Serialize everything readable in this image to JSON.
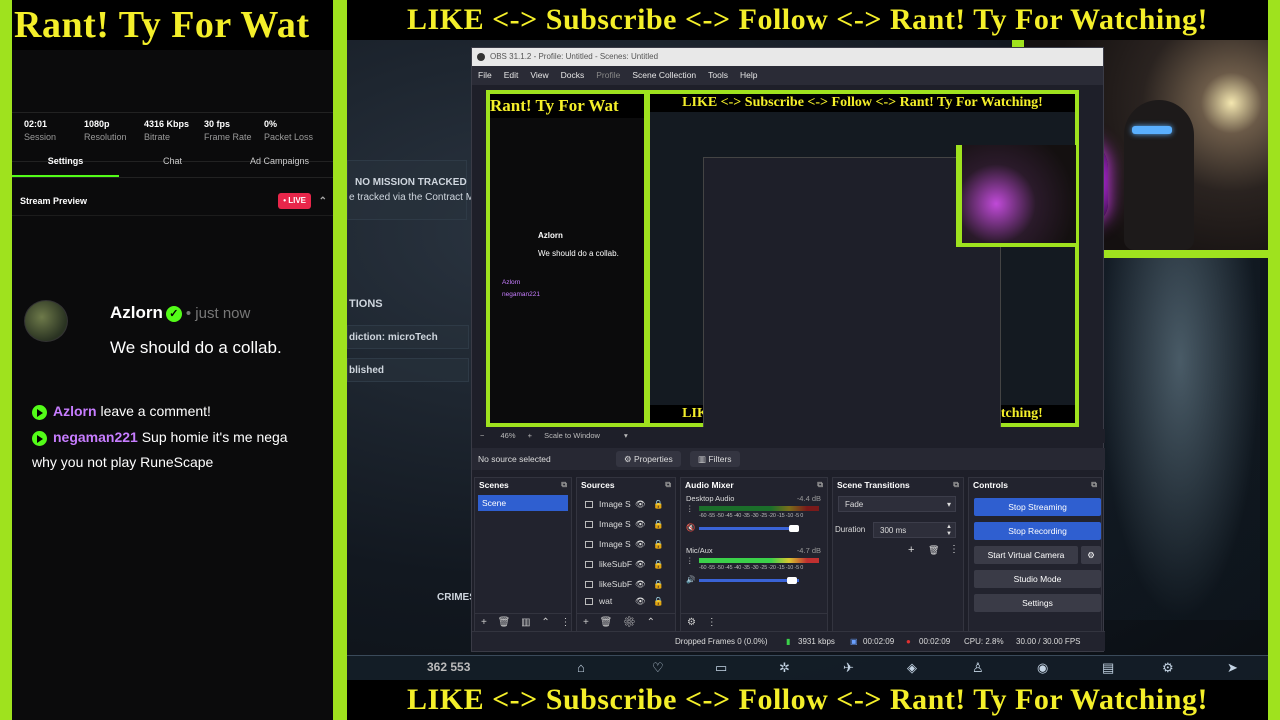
{
  "banners": {
    "left": "Rant! Ty For Wat",
    "top": "LIKE <-> Subscribe <-> Follow <-> Rant! Ty For Watching!",
    "bottom": "LIKE <-> Subscribe <-> Follow <-> Rant! Ty For Watching!"
  },
  "stream": {
    "stats": [
      {
        "value": "02:01",
        "label": "Session"
      },
      {
        "value": "1080p",
        "label": "Resolution"
      },
      {
        "value": "4316 Kbps",
        "label": "Bitrate"
      },
      {
        "value": "30 fps",
        "label": "Frame Rate"
      },
      {
        "value": "0%",
        "label": "Packet Loss"
      }
    ],
    "tabs": [
      "Settings",
      "Chat",
      "Ad Campaigns"
    ],
    "preview_label": "Stream Preview",
    "live_label": "• LIVE"
  },
  "chat": {
    "user": "Azlorn",
    "time": "• just now",
    "message": "We should do a collab.",
    "events": [
      {
        "who": "Azlorn",
        "text": "leave a comment!"
      },
      {
        "who": "negaman221",
        "text": "Sup homie it's me nega"
      }
    ],
    "event_continuation": "why you not play RuneScape"
  },
  "game": {
    "mission": "NO MISSION TRACKED",
    "tracked": "e tracked via the Contract M",
    "section": "TIONS",
    "jurisdiction": "diction: microTech",
    "established": "blished",
    "crime": "CRIMES",
    "score": "362 553"
  },
  "obs": {
    "title": "OBS 31.1.2 - Profile: Untitled - Scenes: Untitled",
    "menu": [
      "File",
      "Edit",
      "View",
      "Docks",
      "Profile",
      "Scene Collection",
      "Tools",
      "Help"
    ],
    "zoom": "46%",
    "scale_mode": "Scale to Window",
    "no_source": "No source selected",
    "properties": "Properties",
    "filters": "Filters",
    "docks": {
      "scenes": "Scenes",
      "sources": "Sources",
      "mixer": "Audio Mixer",
      "transitions": "Scene Transitions",
      "controls": "Controls"
    },
    "scene_items": [
      "Scene"
    ],
    "sources": [
      "Image S",
      "Image S",
      "Image S",
      "likeSubF",
      "likeSubF",
      "wat"
    ],
    "mixer": [
      {
        "name": "Desktop Audio",
        "db": "-4.4 dB"
      },
      {
        "name": "Mic/Aux",
        "db": "-4.7 dB"
      }
    ],
    "meter_scale": "-60 -55 -50 -45 -40 -35 -30 -25 -20 -15 -10 -5 0",
    "transition": "Fade",
    "duration_label": "Duration",
    "duration_value": "300 ms",
    "controls": [
      "Stop Streaming",
      "Stop Recording",
      "Start Virtual Camera",
      "Studio Mode",
      "Settings"
    ],
    "status": {
      "dropped": "Dropped Frames 0 (0.0%)",
      "kbps": "3931 kbps",
      "stream_time": "00:02:09",
      "rec_time": "00:02:09",
      "cpu": "CPU: 2.8%",
      "fps": "30.00 / 30.00 FPS"
    }
  },
  "colors": {
    "frame": "#9fe21e",
    "banner_text": "#f4ef2a",
    "kick_green": "#53fc18",
    "live_red": "#e8264a",
    "obs_blue": "#2f5fd0"
  }
}
